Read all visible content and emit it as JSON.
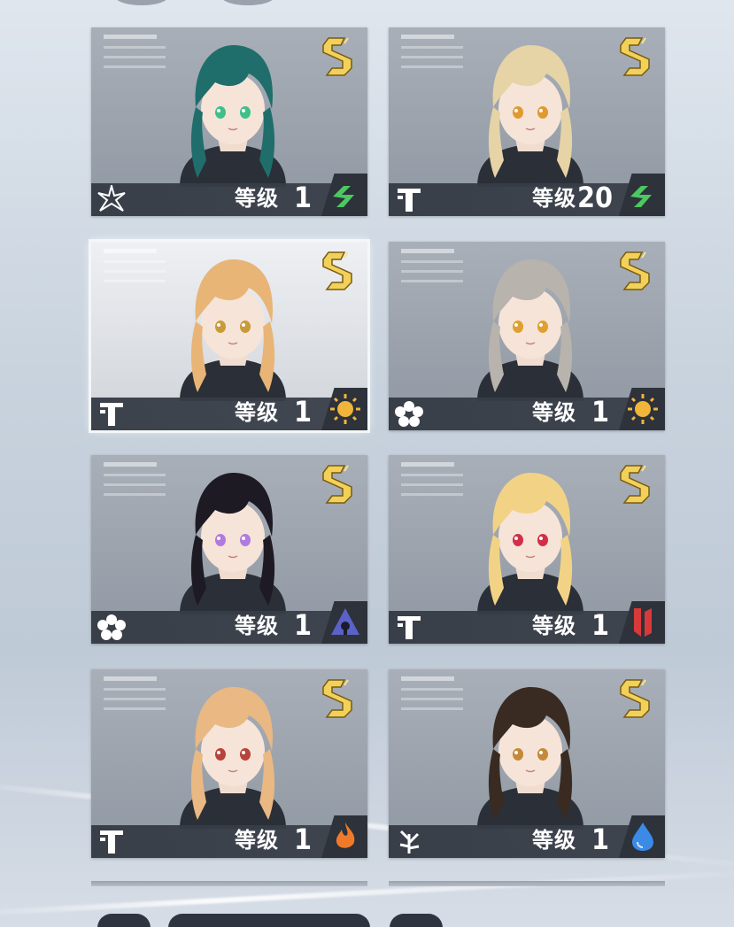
{
  "level_label": "等级",
  "cards": [
    {
      "id": "c1",
      "rank": "S",
      "level": "1",
      "class_icon": "starburst-class-icon",
      "element_icon": "wind-element-icon",
      "element_color": "#4cc860",
      "hair": "#1f6e6c",
      "eyes": "#3fbf8a",
      "selected": false
    },
    {
      "id": "c2",
      "rank": "S",
      "level": "20",
      "class_icon": "pillar-class-icon",
      "element_icon": "wind-element-icon",
      "element_color": "#4cc860",
      "hair": "#e6d3a6",
      "eyes": "#e09a30",
      "selected": false
    },
    {
      "id": "c3",
      "rank": "S",
      "level": "1",
      "class_icon": "pillar-class-icon",
      "element_icon": "sun-element-icon",
      "element_color": "#f0b53a",
      "hair": "#e8b577",
      "eyes": "#c99a3a",
      "selected": true
    },
    {
      "id": "c4",
      "rank": "S",
      "level": "1",
      "class_icon": "flower-class-icon",
      "element_icon": "sun-element-icon",
      "element_color": "#f0b53a",
      "hair": "#b8b3ad",
      "eyes": "#e0a030",
      "selected": false
    },
    {
      "id": "c5",
      "rank": "S",
      "level": "1",
      "class_icon": "flower-class-icon",
      "element_icon": "void-element-icon",
      "element_color": "#5a62c8",
      "hair": "#1e1a24",
      "eyes": "#b07ae0",
      "selected": false
    },
    {
      "id": "c6",
      "rank": "S",
      "level": "1",
      "class_icon": "pillar-class-icon",
      "element_icon": "blade-element-icon",
      "element_color": "#d83a3a",
      "hair": "#f2d386",
      "eyes": "#d0304a",
      "selected": false
    },
    {
      "id": "c7",
      "rank": "S",
      "level": "1",
      "class_icon": "pillar-class-icon",
      "element_icon": "fire-element-icon",
      "element_color": "#f07a2a",
      "hair": "#e9b883",
      "eyes": "#b8433a",
      "selected": false
    },
    {
      "id": "c8",
      "rank": "S",
      "level": "1",
      "class_icon": "branch-class-icon",
      "element_icon": "water-element-icon",
      "element_color": "#3a8ae6",
      "hair": "#3a2b22",
      "eyes": "#c48a3a",
      "selected": false
    }
  ]
}
